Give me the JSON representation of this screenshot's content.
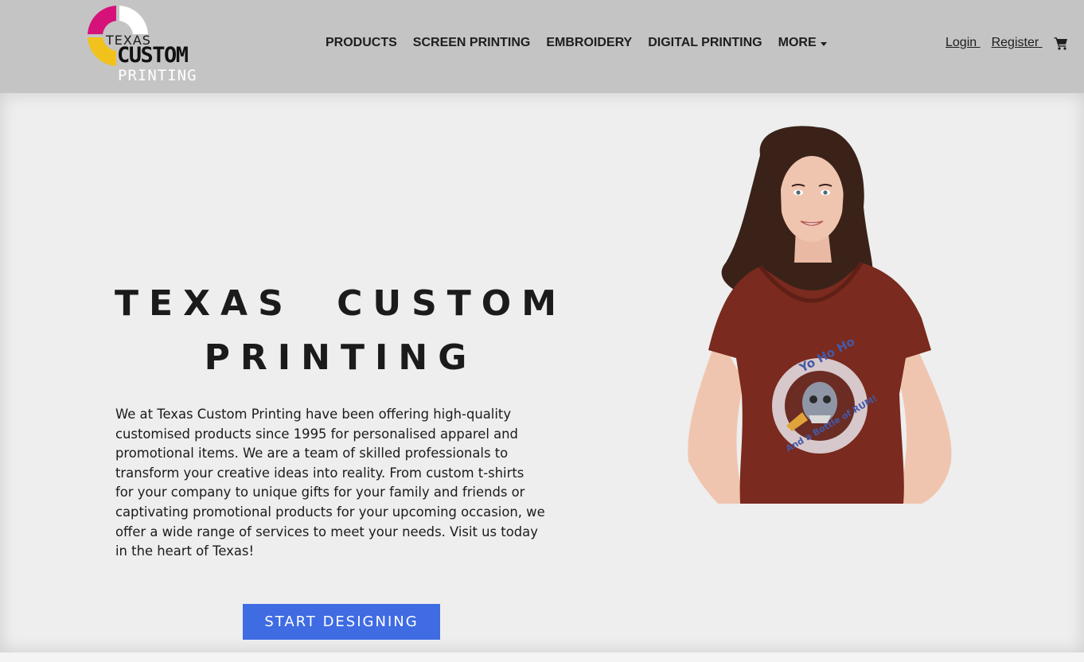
{
  "brand": {
    "logo_line1": "TEXAS",
    "logo_line2": "CUSTOM",
    "logo_line3": "PRINTING",
    "colors": {
      "magenta": "#d6127a",
      "yellow": "#f2c21c",
      "white": "#ffffff"
    }
  },
  "nav": {
    "items": [
      {
        "label": "PRODUCTS"
      },
      {
        "label": "SCREEN PRINTING"
      },
      {
        "label": "EMBROIDERY"
      },
      {
        "label": "DIGITAL PRINTING"
      },
      {
        "label": "MORE",
        "icon": "caret-down-icon"
      }
    ]
  },
  "account": {
    "login_label": "Login ",
    "register_label": "Register ",
    "cart_icon": "shopping-cart-icon"
  },
  "hero": {
    "title": "TEXAS CUSTOM PRINTING",
    "description": "We at Texas Custom Printing have been offering high-quality customised products since 1995 for personalised apparel and promotional items. We are a team of skilled professionals to transform your creative ideas into reality. From custom t-shirts for your company to unique gifts for your family and friends or captivating promotional products for your upcoming occasion, we offer a wide range of services to meet your needs. Visit us today in the heart of Texas!",
    "cta_label": "START DESIGNING",
    "shirt_print_line1": "Yo Ho Ho",
    "shirt_print_line2": "And a Bottle of RUM!"
  },
  "theme": {
    "header_bg": "#c4c4c4",
    "page_bg": "#eeeeee",
    "button_bg": "#3f6be3",
    "text": "#1b1b1b",
    "shirt_color": "#7a2a1e"
  }
}
